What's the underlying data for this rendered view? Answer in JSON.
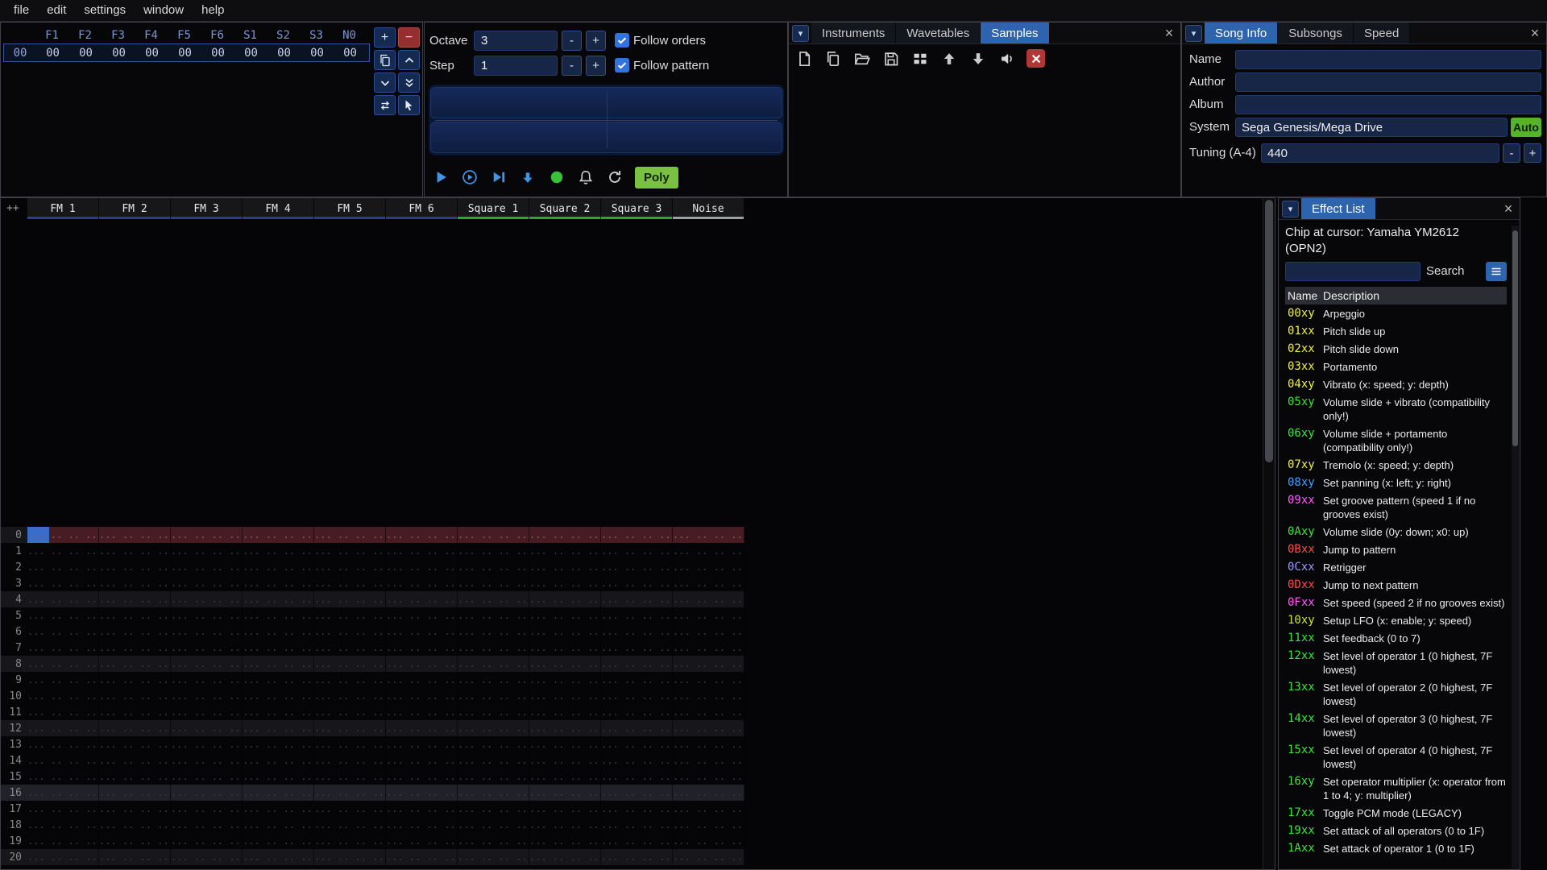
{
  "menu": {
    "items": [
      "file",
      "edit",
      "settings",
      "window",
      "help"
    ]
  },
  "orders": {
    "row_index": "00",
    "columns": [
      "F1",
      "F2",
      "F3",
      "F4",
      "F5",
      "F6",
      "S1",
      "S2",
      "S3",
      "N0"
    ],
    "row_values": [
      "00",
      "00",
      "00",
      "00",
      "00",
      "00",
      "00",
      "00",
      "00",
      "00"
    ],
    "add_label": "+",
    "remove_label": "−",
    "button_icons": [
      "plus-icon",
      "minus-icon",
      "duplicate-icon",
      "chevron-up-icon",
      "chevron-down-icon",
      "double-chevron-down-icon",
      "swap-icon",
      "pointer-icon"
    ]
  },
  "controls": {
    "octave_label": "Octave",
    "octave_value": "3",
    "step_label": "Step",
    "step_value": "1",
    "minus_label": "-",
    "plus_label": "+",
    "follow_orders_label": "Follow orders",
    "follow_pattern_label": "Follow pattern",
    "poly_label": "Poly",
    "transport_icons": [
      "play-icon",
      "play-pattern-icon",
      "play-once-icon",
      "step-row-icon",
      "record-icon",
      "metronome-icon",
      "repeat-icon"
    ]
  },
  "assets": {
    "tabs": [
      "Instruments",
      "Wavetables",
      "Samples"
    ],
    "active_tab": "Samples",
    "toolbar_icons": [
      "file-icon",
      "duplicate-icon",
      "folder-open-icon",
      "save-icon",
      "folders-view-icon",
      "arrow-up-icon",
      "arrow-down-icon",
      "speaker-icon",
      "delete-icon"
    ]
  },
  "song_info": {
    "tabs": [
      "Song Info",
      "Subsongs",
      "Speed"
    ],
    "active_tab": "Song Info",
    "name_label": "Name",
    "name_value": "",
    "author_label": "Author",
    "author_value": "",
    "album_label": "Album",
    "album_value": "",
    "system_label": "System",
    "system_value": "Sega Genesis/Mega Drive",
    "auto_label": "Auto",
    "tuning_label": "Tuning (A-4)",
    "tuning_value": "440",
    "minus_label": "-",
    "plus_label": "+"
  },
  "pattern": {
    "corner_label": "++",
    "channels": [
      {
        "name": "FM 1",
        "type": "fm"
      },
      {
        "name": "FM 2",
        "type": "fm"
      },
      {
        "name": "FM 3",
        "type": "fm"
      },
      {
        "name": "FM 4",
        "type": "fm"
      },
      {
        "name": "FM 5",
        "type": "fm"
      },
      {
        "name": "FM 6",
        "type": "fm"
      },
      {
        "name": "Square 1",
        "type": "square"
      },
      {
        "name": "Square 2",
        "type": "square"
      },
      {
        "name": "Square 3",
        "type": "square"
      },
      {
        "name": "Noise",
        "type": "noise"
      }
    ],
    "rows": [
      "0",
      "1",
      "2",
      "3",
      "4",
      "5",
      "6",
      "7",
      "8",
      "9",
      "10",
      "11",
      "12",
      "13",
      "14",
      "15",
      "16",
      "17",
      "18",
      "19",
      "20"
    ],
    "empty_cell": "... .. .. ....",
    "selected_row": "0",
    "strong_highlight_row": "16"
  },
  "effect_list": {
    "title": "Effect List",
    "chip_label": "Chip at cursor: Yamaha YM2612 (OPN2)",
    "search_value": "",
    "search_label": "Search",
    "columns": {
      "name": "Name",
      "description": "Description"
    },
    "effects": [
      {
        "code": "00xy",
        "desc": "Arpeggio",
        "color": "#efef44"
      },
      {
        "code": "01xx",
        "desc": "Pitch slide up",
        "color": "#efef44"
      },
      {
        "code": "02xx",
        "desc": "Pitch slide down",
        "color": "#efef44"
      },
      {
        "code": "03xx",
        "desc": "Portamento",
        "color": "#efef44"
      },
      {
        "code": "04xy",
        "desc": "Vibrato (x: speed; y: depth)",
        "color": "#efef44"
      },
      {
        "code": "05xy",
        "desc": "Volume slide + vibrato (compatibility only!)",
        "color": "#3ce23c"
      },
      {
        "code": "06xy",
        "desc": "Volume slide + portamento (compatibility only!)",
        "color": "#3ce23c"
      },
      {
        "code": "07xy",
        "desc": "Tremolo (x: speed; y: depth)",
        "color": "#efef44"
      },
      {
        "code": "08xy",
        "desc": "Set panning (x: left; y: right)",
        "color": "#3f9fff"
      },
      {
        "code": "09xx",
        "desc": "Set groove pattern (speed 1 if no grooves exist)",
        "color": "#ff57ff"
      },
      {
        "code": "0Axy",
        "desc": "Volume slide (0y: down; x0: up)",
        "color": "#3ce23c"
      },
      {
        "code": "0Bxx",
        "desc": "Jump to pattern",
        "color": "#ff4a4a"
      },
      {
        "code": "0Cxx",
        "desc": "Retrigger",
        "color": "#9b9bff"
      },
      {
        "code": "0Dxx",
        "desc": "Jump to next pattern",
        "color": "#ff4a4a"
      },
      {
        "code": "0Fxx",
        "desc": "Set speed (speed 2 if no grooves exist)",
        "color": "#ff57ff"
      },
      {
        "code": "10xy",
        "desc": "Setup LFO (x: enable; y: speed)",
        "color": "#cfe23c"
      },
      {
        "code": "11xx",
        "desc": "Set feedback (0 to 7)",
        "color": "#3ce23c"
      },
      {
        "code": "12xx",
        "desc": "Set level of operator 1 (0 highest, 7F lowest)",
        "color": "#3ce23c"
      },
      {
        "code": "13xx",
        "desc": "Set level of operator 2 (0 highest, 7F lowest)",
        "color": "#3ce23c"
      },
      {
        "code": "14xx",
        "desc": "Set level of operator 3 (0 highest, 7F lowest)",
        "color": "#3ce23c"
      },
      {
        "code": "15xx",
        "desc": "Set level of operator 4 (0 highest, 7F lowest)",
        "color": "#3ce23c"
      },
      {
        "code": "16xy",
        "desc": "Set operator multiplier (x: operator from 1 to 4; y: multiplier)",
        "color": "#3ce23c"
      },
      {
        "code": "17xx",
        "desc": "Toggle PCM mode (LEGACY)",
        "color": "#3ce23c"
      },
      {
        "code": "19xx",
        "desc": "Set attack of all operators (0 to 1F)",
        "color": "#3ce23c"
      },
      {
        "code": "1Axx",
        "desc": "Set attack of operator 1 (0 to 1F)",
        "color": "#3ce23c"
      }
    ]
  },
  "colors": {
    "accent": "#2e63ad",
    "channel_fm": "#2c3c96",
    "channel_square": "#19b419",
    "channel_noise": "#9aa0a0",
    "cursor": "#3a6dc8",
    "selected_row_bg": "#471c23"
  }
}
